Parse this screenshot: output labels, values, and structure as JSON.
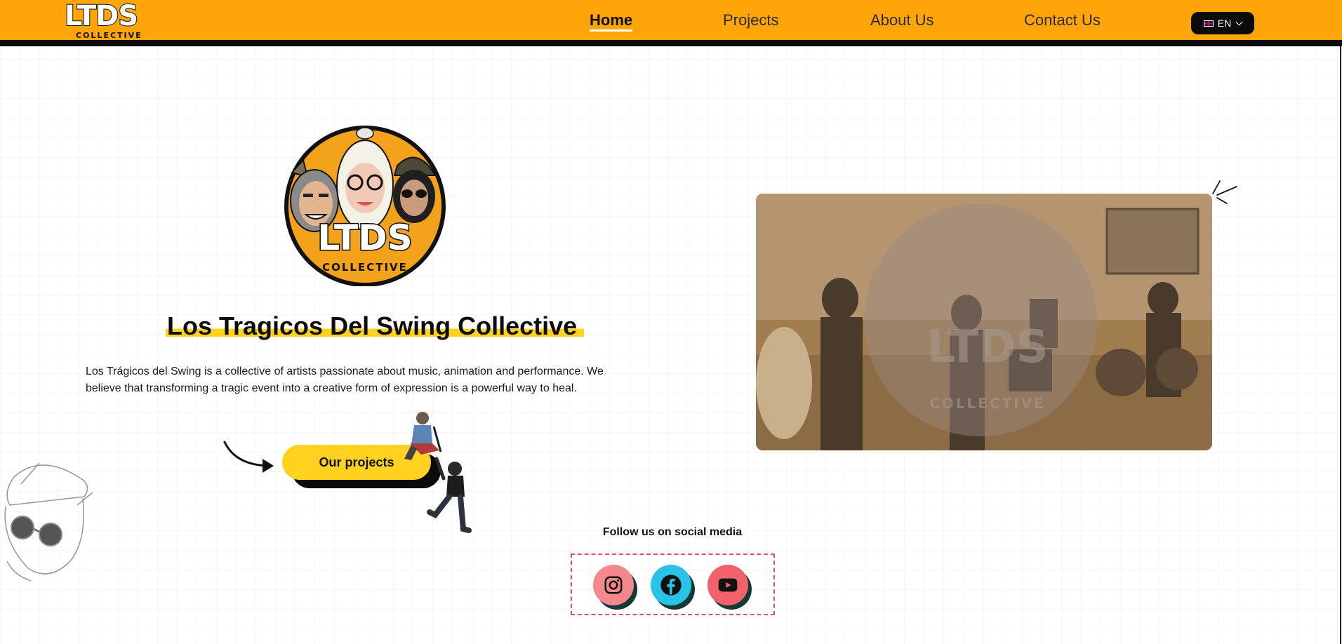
{
  "header": {
    "logo_text": "LTDS",
    "logo_subtext": "COLLECTIVE",
    "nav": [
      {
        "label": "Home",
        "active": true
      },
      {
        "label": "Projects",
        "active": false
      },
      {
        "label": "About Us",
        "active": false
      },
      {
        "label": "Contact Us",
        "active": false
      }
    ],
    "language": {
      "label": "EN",
      "flag_icon": "uk-flag-icon"
    }
  },
  "hero": {
    "emblem_text": "LTDS",
    "emblem_subtext": "COLLECTIVE",
    "title": "Los Tragicos Del Swing Collective",
    "description": "Los Trágicos del Swing is a collective of artists passionate about music, animation and performance. We believe that transforming a tragic event into a creative form of expression is a powerful way to heal.",
    "cta_label": "Our projects"
  },
  "video": {
    "watermark_text": "LTDS",
    "watermark_subtext": "COLLECTIVE"
  },
  "social": {
    "title": "Follow us on social media",
    "links": [
      {
        "icon": "instagram-icon"
      },
      {
        "icon": "facebook-icon"
      },
      {
        "icon": "youtube-icon"
      }
    ]
  },
  "colors": {
    "header_bg": "#ffa50a",
    "accent_yellow": "#ffd21f",
    "dark": "#0b0b0b"
  }
}
